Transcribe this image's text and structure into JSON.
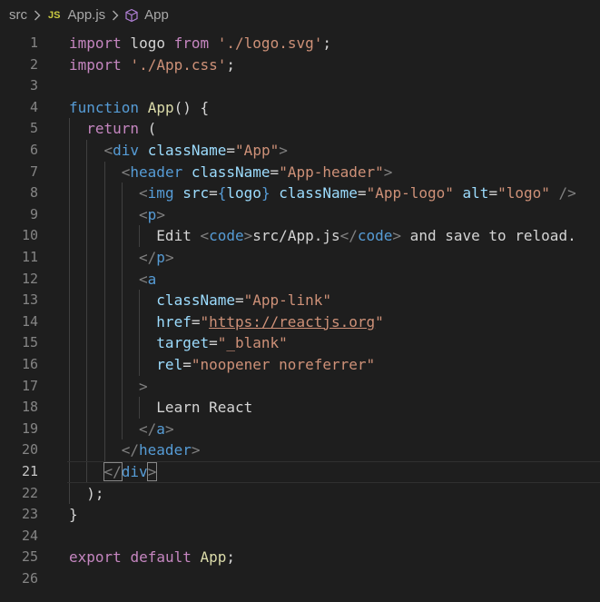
{
  "breadcrumb": {
    "folder": "src",
    "file": "App.js",
    "file_icon": "JS",
    "symbol": "App"
  },
  "editor": {
    "current_line": 21,
    "lines": [
      {
        "n": "1",
        "indent": 0,
        "tokens": [
          {
            "t": "import",
            "c": "kw"
          },
          {
            "t": " logo ",
            "c": "plain"
          },
          {
            "t": "from",
            "c": "kw"
          },
          {
            "t": " ",
            "c": "plain"
          },
          {
            "t": "'./logo.svg'",
            "c": "str"
          },
          {
            "t": ";",
            "c": "plain"
          }
        ]
      },
      {
        "n": "2",
        "indent": 0,
        "tokens": [
          {
            "t": "import",
            "c": "kw"
          },
          {
            "t": " ",
            "c": "plain"
          },
          {
            "t": "'./App.css'",
            "c": "str"
          },
          {
            "t": ";",
            "c": "plain"
          }
        ]
      },
      {
        "n": "3",
        "indent": 0,
        "tokens": []
      },
      {
        "n": "4",
        "indent": 0,
        "tokens": [
          {
            "t": "function",
            "c": "blue"
          },
          {
            "t": " ",
            "c": "plain"
          },
          {
            "t": "App",
            "c": "fn"
          },
          {
            "t": "() {",
            "c": "plain"
          }
        ]
      },
      {
        "n": "5",
        "indent": 1,
        "tokens": [
          {
            "t": "return",
            "c": "kw"
          },
          {
            "t": " (",
            "c": "plain"
          }
        ]
      },
      {
        "n": "6",
        "indent": 2,
        "tokens": [
          {
            "t": "<",
            "c": "punc"
          },
          {
            "t": "div",
            "c": "tag"
          },
          {
            "t": " ",
            "c": "plain"
          },
          {
            "t": "className",
            "c": "attr"
          },
          {
            "t": "=",
            "c": "plain"
          },
          {
            "t": "\"App\"",
            "c": "str"
          },
          {
            "t": ">",
            "c": "punc"
          }
        ]
      },
      {
        "n": "7",
        "indent": 3,
        "tokens": [
          {
            "t": "<",
            "c": "punc"
          },
          {
            "t": "header",
            "c": "tag"
          },
          {
            "t": " ",
            "c": "plain"
          },
          {
            "t": "className",
            "c": "attr"
          },
          {
            "t": "=",
            "c": "plain"
          },
          {
            "t": "\"App-header\"",
            "c": "str"
          },
          {
            "t": ">",
            "c": "punc"
          }
        ]
      },
      {
        "n": "8",
        "indent": 4,
        "tokens": [
          {
            "t": "<",
            "c": "punc"
          },
          {
            "t": "img",
            "c": "tag"
          },
          {
            "t": " ",
            "c": "plain"
          },
          {
            "t": "src",
            "c": "attr"
          },
          {
            "t": "=",
            "c": "plain"
          },
          {
            "t": "{",
            "c": "blue"
          },
          {
            "t": "logo",
            "c": "var"
          },
          {
            "t": "}",
            "c": "blue"
          },
          {
            "t": " ",
            "c": "plain"
          },
          {
            "t": "className",
            "c": "attr"
          },
          {
            "t": "=",
            "c": "plain"
          },
          {
            "t": "\"App-logo\"",
            "c": "str"
          },
          {
            "t": " ",
            "c": "plain"
          },
          {
            "t": "alt",
            "c": "attr"
          },
          {
            "t": "=",
            "c": "plain"
          },
          {
            "t": "\"logo\"",
            "c": "str"
          },
          {
            "t": " ",
            "c": "plain"
          },
          {
            "t": "/>",
            "c": "punc"
          }
        ]
      },
      {
        "n": "9",
        "indent": 4,
        "tokens": [
          {
            "t": "<",
            "c": "punc"
          },
          {
            "t": "p",
            "c": "tag"
          },
          {
            "t": ">",
            "c": "punc"
          }
        ]
      },
      {
        "n": "10",
        "indent": 5,
        "tokens": [
          {
            "t": "Edit ",
            "c": "plain"
          },
          {
            "t": "<",
            "c": "punc"
          },
          {
            "t": "code",
            "c": "tag"
          },
          {
            "t": ">",
            "c": "punc"
          },
          {
            "t": "src/App.js",
            "c": "plain"
          },
          {
            "t": "</",
            "c": "punc"
          },
          {
            "t": "code",
            "c": "tag"
          },
          {
            "t": ">",
            "c": "punc"
          },
          {
            "t": " and save to reload.",
            "c": "plain"
          }
        ]
      },
      {
        "n": "11",
        "indent": 4,
        "tokens": [
          {
            "t": "</",
            "c": "punc"
          },
          {
            "t": "p",
            "c": "tag"
          },
          {
            "t": ">",
            "c": "punc"
          }
        ]
      },
      {
        "n": "12",
        "indent": 4,
        "tokens": [
          {
            "t": "<",
            "c": "punc"
          },
          {
            "t": "a",
            "c": "tag"
          }
        ]
      },
      {
        "n": "13",
        "indent": 5,
        "tokens": [
          {
            "t": "className",
            "c": "attr"
          },
          {
            "t": "=",
            "c": "plain"
          },
          {
            "t": "\"App-link\"",
            "c": "str"
          }
        ]
      },
      {
        "n": "14",
        "indent": 5,
        "tokens": [
          {
            "t": "href",
            "c": "attr"
          },
          {
            "t": "=",
            "c": "plain"
          },
          {
            "t": "\"",
            "c": "str"
          },
          {
            "t": "https://reactjs.org",
            "c": "str link"
          },
          {
            "t": "\"",
            "c": "str"
          }
        ]
      },
      {
        "n": "15",
        "indent": 5,
        "tokens": [
          {
            "t": "target",
            "c": "attr"
          },
          {
            "t": "=",
            "c": "plain"
          },
          {
            "t": "\"_blank\"",
            "c": "str"
          }
        ]
      },
      {
        "n": "16",
        "indent": 5,
        "tokens": [
          {
            "t": "rel",
            "c": "attr"
          },
          {
            "t": "=",
            "c": "plain"
          },
          {
            "t": "\"noopener noreferrer\"",
            "c": "str"
          }
        ]
      },
      {
        "n": "17",
        "indent": 4,
        "tokens": [
          {
            "t": ">",
            "c": "punc"
          }
        ]
      },
      {
        "n": "18",
        "indent": 5,
        "tokens": [
          {
            "t": "Learn React",
            "c": "plain"
          }
        ]
      },
      {
        "n": "19",
        "indent": 4,
        "tokens": [
          {
            "t": "</",
            "c": "punc"
          },
          {
            "t": "a",
            "c": "tag"
          },
          {
            "t": ">",
            "c": "punc"
          }
        ]
      },
      {
        "n": "20",
        "indent": 3,
        "tokens": [
          {
            "t": "</",
            "c": "punc"
          },
          {
            "t": "header",
            "c": "tag"
          },
          {
            "t": ">",
            "c": "punc"
          }
        ]
      },
      {
        "n": "21",
        "indent": 2,
        "tokens": [
          {
            "t": "</",
            "c": "punc bracket-match"
          },
          {
            "t": "div",
            "c": "tag"
          },
          {
            "t": ">",
            "c": "punc bracket-match"
          }
        ]
      },
      {
        "n": "22",
        "indent": 1,
        "tokens": [
          {
            "t": ");",
            "c": "plain"
          }
        ]
      },
      {
        "n": "23",
        "indent": 0,
        "tokens": [
          {
            "t": "}",
            "c": "plain"
          }
        ]
      },
      {
        "n": "24",
        "indent": 0,
        "tokens": []
      },
      {
        "n": "25",
        "indent": 0,
        "tokens": [
          {
            "t": "export",
            "c": "kw"
          },
          {
            "t": " ",
            "c": "plain"
          },
          {
            "t": "default",
            "c": "kw"
          },
          {
            "t": " ",
            "c": "plain"
          },
          {
            "t": "App",
            "c": "fn"
          },
          {
            "t": ";",
            "c": "plain"
          }
        ]
      },
      {
        "n": "26",
        "indent": 0,
        "tokens": []
      }
    ]
  }
}
